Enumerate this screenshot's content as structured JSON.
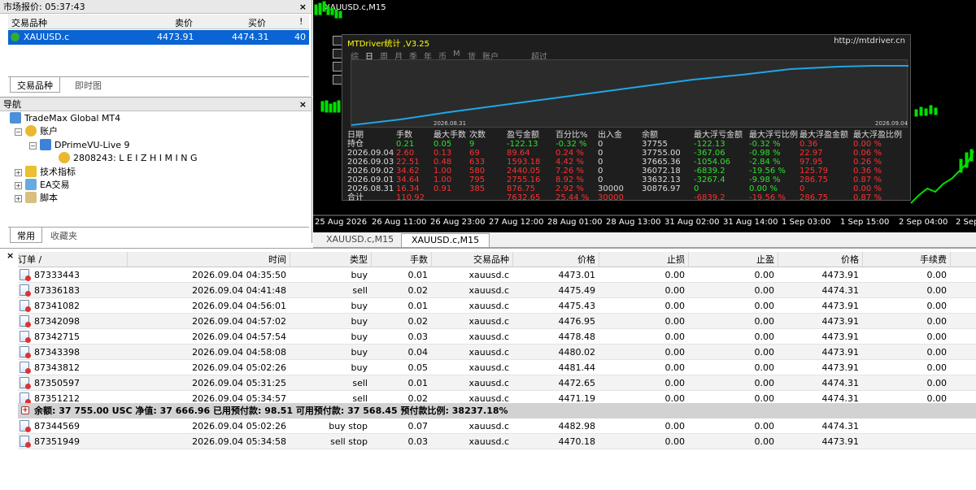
{
  "market_watch": {
    "title": "市场报价: 05:37:43",
    "close": "×",
    "col_symbol": "交易品种",
    "col_bid": "卖价",
    "col_ask": "买价",
    "col_spread": "!",
    "row": {
      "symbol": "XAUUSD.c",
      "bid": "4473.91",
      "ask": "4474.31",
      "spread": "40"
    },
    "tabs": [
      "交易品种",
      "即时图"
    ]
  },
  "navigator": {
    "title": "导航",
    "close": "×",
    "items": [
      "TradeMax Global MT4",
      "账户",
      "DPrimeVU-Live 9",
      "2808243: L E I Z H I M I N G",
      "技术指标",
      "EA交易",
      "脚本"
    ],
    "tabs": [
      "常用",
      "收藏夹"
    ]
  },
  "chart": {
    "title": "XAUUSD.c,M15",
    "time_labels": [
      "25 Aug 2026",
      "26 Aug 11:00",
      "26 Aug 23:00",
      "27 Aug 12:00",
      "28 Aug 01:00",
      "28 Aug 13:00",
      "31 Aug 02:00",
      "31 Aug 14:00",
      "1 Sep 03:00",
      "1 Sep 15:00",
      "2 Sep 04:00",
      "2 Sep"
    ],
    "tabs": [
      "XAUUSD.c,M15",
      "XAUUSD.c,M15"
    ]
  },
  "mtdriver": {
    "title": "MTDriver统计  ,V3.25",
    "url": "http://mtdriver.cn",
    "menu": [
      "综",
      "日",
      "周",
      "月",
      "季",
      "年",
      "币",
      "M",
      "货",
      "账户",
      "超过"
    ],
    "graph_start": "2026.08.31",
    "graph_end": "2026.09.04",
    "headers": [
      "日期",
      "手数",
      "最大手数",
      "次数",
      "盈亏金额",
      "百分比%",
      "出入金",
      "余额",
      "最大浮亏金额",
      "最大浮亏比例",
      "最大浮盈金额",
      "最大浮盈比例"
    ],
    "rows": [
      [
        "持仓",
        "0.21",
        "0.05",
        "9",
        "-122.13",
        "-0.32 %",
        "0",
        "37755",
        "-122.13",
        "-0.32 %",
        "0.36",
        "0.00 %"
      ],
      [
        "2026.09.04",
        "2.60",
        "0.13",
        "69",
        "89.64",
        "0.24 %",
        "0",
        "37755.00",
        "-367.06",
        "-0.98 %",
        "22.97",
        "0.06 %"
      ],
      [
        "2026.09.03",
        "22.51",
        "0.48",
        "633",
        "1593.18",
        "4.42 %",
        "0",
        "37665.36",
        "-1054.06",
        "-2.84 %",
        "97.95",
        "0.26 %"
      ],
      [
        "2026.09.02",
        "34.62",
        "1.00",
        "580",
        "2440.05",
        "7.26 %",
        "0",
        "36072.18",
        "-6839.2",
        "-19.56 %",
        "125.79",
        "0.36 %"
      ],
      [
        "2026.09.01",
        "34.64",
        "1.00",
        "795",
        "2755.16",
        "8.92 %",
        "0",
        "33632.13",
        "-3267.4",
        "-9.98 %",
        "286.75",
        "0.87 %"
      ],
      [
        "2026.08.31",
        "16.34",
        "0.91",
        "385",
        "876.75",
        "2.92 %",
        "30000",
        "30876.97",
        "0",
        "0.00 %",
        "0",
        "0.00 %"
      ],
      [
        "合计",
        "110.92",
        "",
        "",
        "7632.65",
        "25.44 %",
        "30000",
        "",
        "-6839.2",
        "-19.56 %",
        "286.75",
        "0.87 %"
      ]
    ]
  },
  "orders": {
    "close": "×",
    "headers": [
      "订单 /",
      "时间",
      "类型",
      "手数",
      "交易品种",
      "价格",
      "止损",
      "止盈",
      "价格",
      "手续费"
    ],
    "rows": [
      [
        "87333443",
        "2026.09.04 04:35:50",
        "buy",
        "0.01",
        "xauusd.c",
        "4473.01",
        "0.00",
        "0.00",
        "4473.91",
        "0.00"
      ],
      [
        "87336183",
        "2026.09.04 04:41:48",
        "sell",
        "0.02",
        "xauusd.c",
        "4475.49",
        "0.00",
        "0.00",
        "4474.31",
        "0.00"
      ],
      [
        "87341082",
        "2026.09.04 04:56:01",
        "buy",
        "0.01",
        "xauusd.c",
        "4475.43",
        "0.00",
        "0.00",
        "4473.91",
        "0.00"
      ],
      [
        "87342098",
        "2026.09.04 04:57:02",
        "buy",
        "0.02",
        "xauusd.c",
        "4476.95",
        "0.00",
        "0.00",
        "4473.91",
        "0.00"
      ],
      [
        "87342715",
        "2026.09.04 04:57:54",
        "buy",
        "0.03",
        "xauusd.c",
        "4478.48",
        "0.00",
        "0.00",
        "4473.91",
        "0.00"
      ],
      [
        "87343398",
        "2026.09.04 04:58:08",
        "buy",
        "0.04",
        "xauusd.c",
        "4480.02",
        "0.00",
        "0.00",
        "4473.91",
        "0.00"
      ],
      [
        "87343812",
        "2026.09.04 05:02:26",
        "buy",
        "0.05",
        "xauusd.c",
        "4481.44",
        "0.00",
        "0.00",
        "4473.91",
        "0.00"
      ],
      [
        "87350597",
        "2026.09.04 05:31:25",
        "sell",
        "0.01",
        "xauusd.c",
        "4472.65",
        "0.00",
        "0.00",
        "4474.31",
        "0.00"
      ],
      [
        "87351212",
        "2026.09.04 05:34:57",
        "sell",
        "0.02",
        "xauusd.c",
        "4471.19",
        "0.00",
        "0.00",
        "4474.31",
        "0.00"
      ]
    ],
    "balance": "余额: 37 755.00 USC  净值: 37 666.96  已用预付款: 98.51  可用预付款: 37 568.45  预付款比例: 38237.18%",
    "pending": [
      [
        "87344569",
        "2026.09.04 05:02:26",
        "buy stop",
        "0.07",
        "xauusd.c",
        "4482.98",
        "0.00",
        "0.00",
        "4474.31",
        ""
      ],
      [
        "87351949",
        "2026.09.04 05:34:58",
        "sell stop",
        "0.03",
        "xauusd.c",
        "4470.18",
        "0.00",
        "0.00",
        "4473.91",
        ""
      ]
    ]
  },
  "colors": {
    "selection": "#0a64d4",
    "chart_bg": "#000000",
    "candle": "#00ff00",
    "mtd_line": "#1fa6e8",
    "mtd_loss": "#ff3030",
    "mtd_gain": "#30e030"
  }
}
